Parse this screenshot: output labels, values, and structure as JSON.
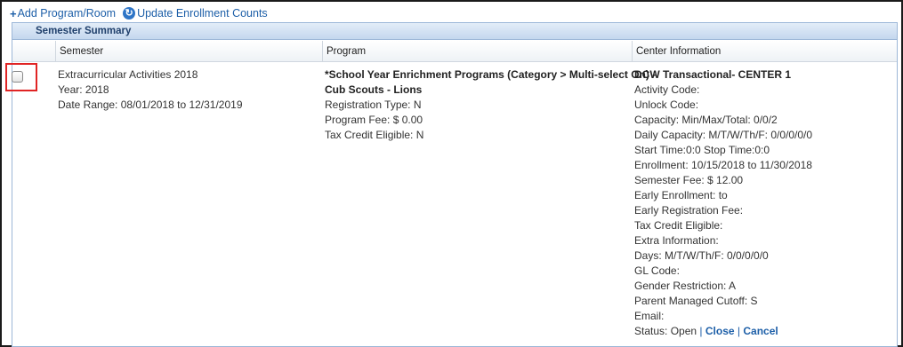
{
  "toolbar": {
    "add_label": "Add Program/Room",
    "update_label": "Update Enrollment Counts"
  },
  "panel": {
    "title": "Semester Summary",
    "columns": [
      "Semester",
      "Program",
      "Center Information"
    ]
  },
  "row": {
    "semester": {
      "name": "Extracurricular Activities 2018",
      "year": "Year: 2018",
      "date_range": "Date Range: 08/01/2018 to 12/31/2019"
    },
    "program": {
      "category": "*School Year Enrichment Programs (Category > Multi-select On) -",
      "name": "Cub Scouts - Lions",
      "registration_type": "Registration Type: N",
      "program_fee": "Program Fee: $ 0.00",
      "tax_credit": "Tax Credit Eligible: N"
    },
    "center": {
      "name": "DCW Transactional- CENTER 1",
      "lines": [
        "Activity Code:",
        "Unlock Code:",
        "Capacity: Min/Max/Total: 0/0/2",
        "Daily Capacity: M/T/W/Th/F: 0/0/0/0/0",
        "Start Time:0:0 Stop Time:0:0",
        "Enrollment: 10/15/2018 to 11/30/2018",
        "Semester Fee: $ 12.00",
        "Early Enrollment: to",
        "Early Registration Fee:",
        "Tax Credit Eligible:",
        "Extra Information:",
        "Days: M/T/W/Th/F: 0/0/0/0/0",
        "GL Code:",
        "Gender Restriction: A",
        "Parent Managed Cutoff: S",
        "Email:"
      ],
      "status_prefix": "Status: Open",
      "status_sep": "|",
      "close_label": "Close",
      "cancel_label": "Cancel"
    }
  },
  "colors": {
    "link": "#1d5fa8",
    "highlight": "#e02424",
    "header_text": "#1f3f6b"
  }
}
